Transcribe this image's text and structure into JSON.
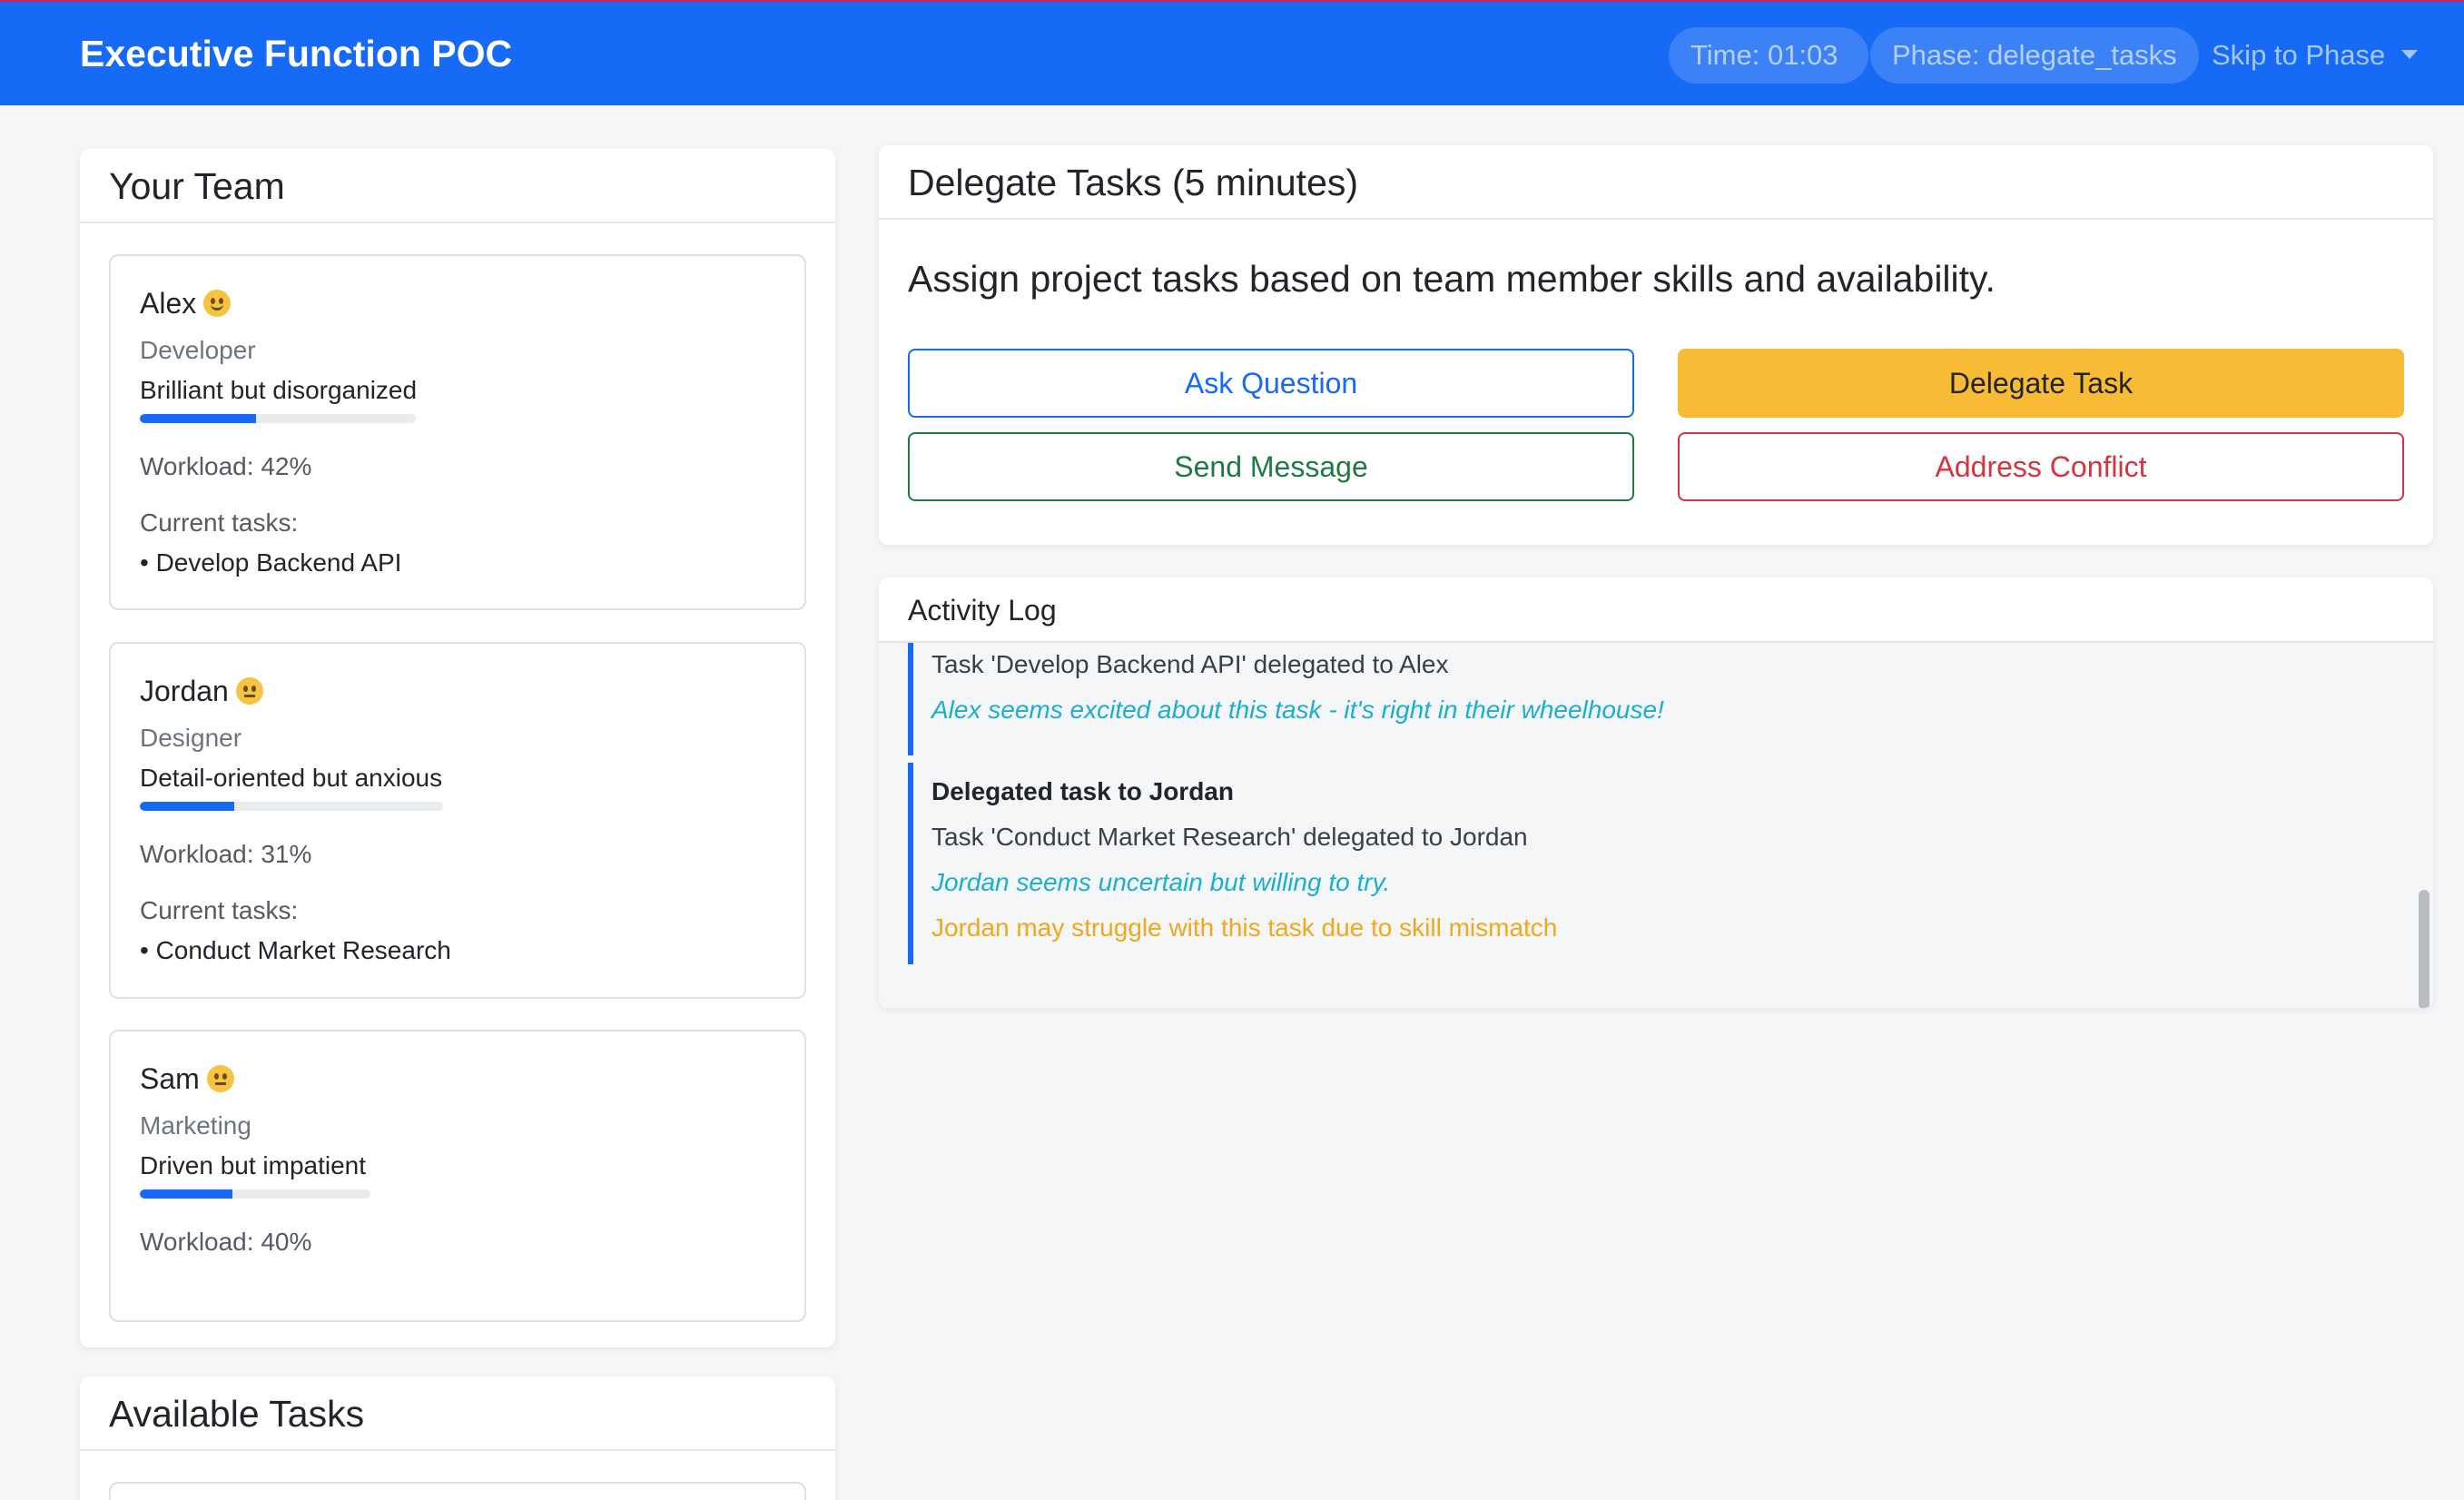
{
  "header": {
    "brand": "Executive Function POC",
    "time_label": "Time: 01:03",
    "phase_label": "Phase: delegate_tasks",
    "skip_label": "Skip to Phase",
    "bg_color": "#176af5"
  },
  "team": {
    "title": "Your Team",
    "members": [
      {
        "name": "Alex",
        "mood_icon": "smiling-face-icon",
        "role": "Developer",
        "trait": "Brilliant but disorganized",
        "workload_fraction": 0.42,
        "workload_label": "Workload: 42%",
        "tasks_label": "Current tasks:",
        "tasks": [
          "• Develop Backend API"
        ]
      },
      {
        "name": "Jordan",
        "mood_icon": "neutral-face-icon",
        "role": "Designer",
        "trait": "Detail-oriented but anxious",
        "workload_fraction": 0.31,
        "workload_label": "Workload: 31%",
        "tasks_label": "Current tasks:",
        "tasks": [
          "• Conduct Market Research"
        ]
      },
      {
        "name": "Sam",
        "mood_icon": "neutral-face-icon",
        "role": "Marketing",
        "trait": "Driven but impatient",
        "workload_fraction": 0.4,
        "workload_label": "Workload: 40%"
      }
    ]
  },
  "available_tasks": {
    "title": "Available Tasks"
  },
  "delegate": {
    "title": "Delegate Tasks (5 minutes)",
    "description": "Assign project tasks based on team member skills and availability.",
    "buttons": {
      "ask": "Ask Question",
      "delegate": "Delegate Task",
      "message": "Send Message",
      "conflict": "Address Conflict"
    }
  },
  "activity_log": {
    "title": "Activity Log",
    "entries": [
      {
        "lines": [
          {
            "text": "Task 'Develop Backend API' delegated to Alex",
            "kind": "plain"
          },
          {
            "text": "Alex seems excited about this task - it's right in their wheelhouse!",
            "kind": "reaction"
          }
        ]
      },
      {
        "title": "Delegated task to Jordan",
        "lines": [
          {
            "text": "Task 'Conduct Market Research' delegated to Jordan",
            "kind": "plain"
          },
          {
            "text": "Jordan seems uncertain but willing to try.",
            "kind": "reaction"
          },
          {
            "text": "Jordan may struggle with this task due to skill mismatch",
            "kind": "warning"
          }
        ]
      }
    ]
  },
  "colors": {
    "primary": "#176af5",
    "warning": "#f8bb36",
    "success": "#1d7a45",
    "danger": "#d63341",
    "info": "#1aaed1"
  }
}
